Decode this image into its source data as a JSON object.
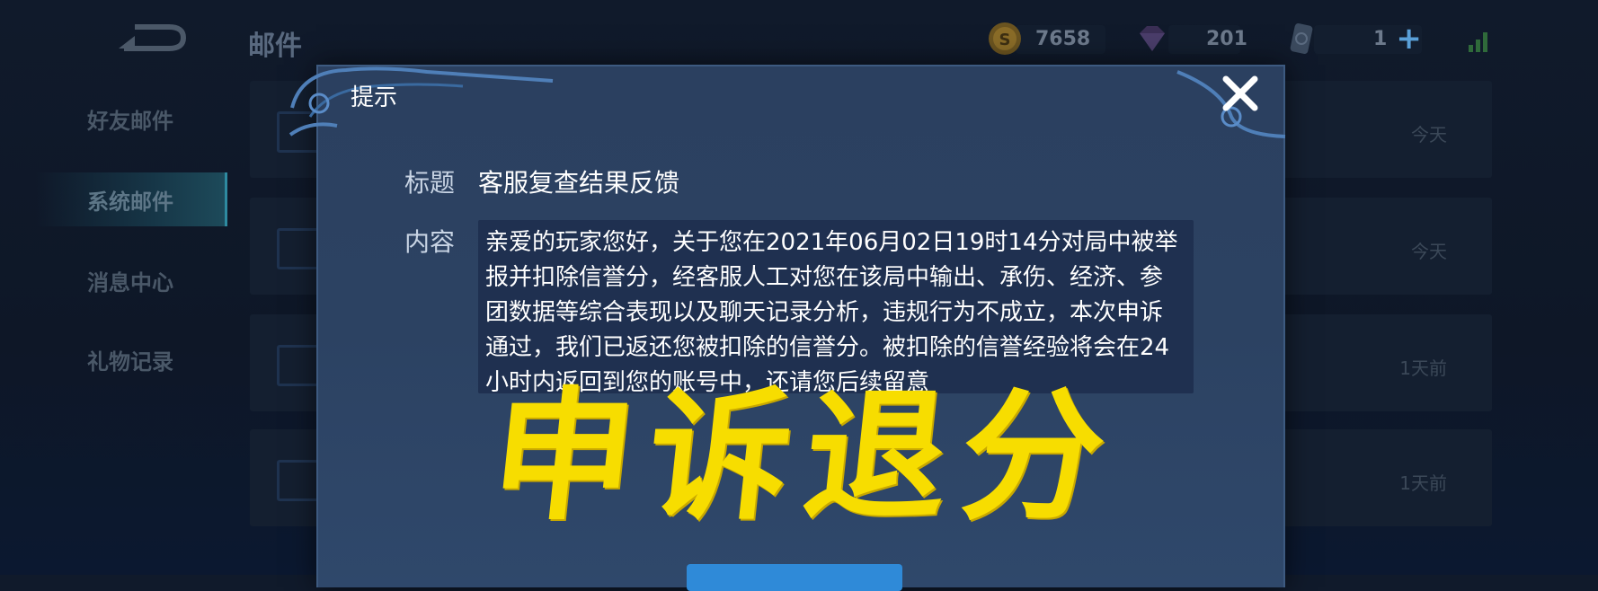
{
  "header": {
    "title": "邮件",
    "gold": "7658",
    "gems": "201",
    "tickets": "1"
  },
  "sidebar": {
    "items": [
      {
        "label": "好友邮件"
      },
      {
        "label": "系统邮件"
      },
      {
        "label": "消息中心"
      },
      {
        "label": "礼物记录"
      }
    ]
  },
  "mail_list": [
    {
      "time": "今天"
    },
    {
      "time": "今天"
    },
    {
      "time": "1天前"
    },
    {
      "time": "1天前"
    }
  ],
  "dialog": {
    "title": "提示",
    "subject_label": "标题",
    "subject": "客服复查结果反馈",
    "content_label": "内容",
    "content": "亲爱的玩家您好，关于您在2021年06月02日19时14分对局中被举报并扣除信誉分，经客服人工对您在该局中输出、承伤、经济、参团数据等综合表现以及聊天记录分析，违规行为不成立，本次申诉通过，我们已返还您被扣除的信誉分。被扣除的信誉经验将会在24小时内返回到您的账号中，还请您后续留意"
  },
  "overlay": {
    "text": "申诉退分"
  },
  "colors": {
    "accent": "#f7dd00",
    "dialog_bg": "#2c4262",
    "confirm": "#2f8ad8"
  }
}
